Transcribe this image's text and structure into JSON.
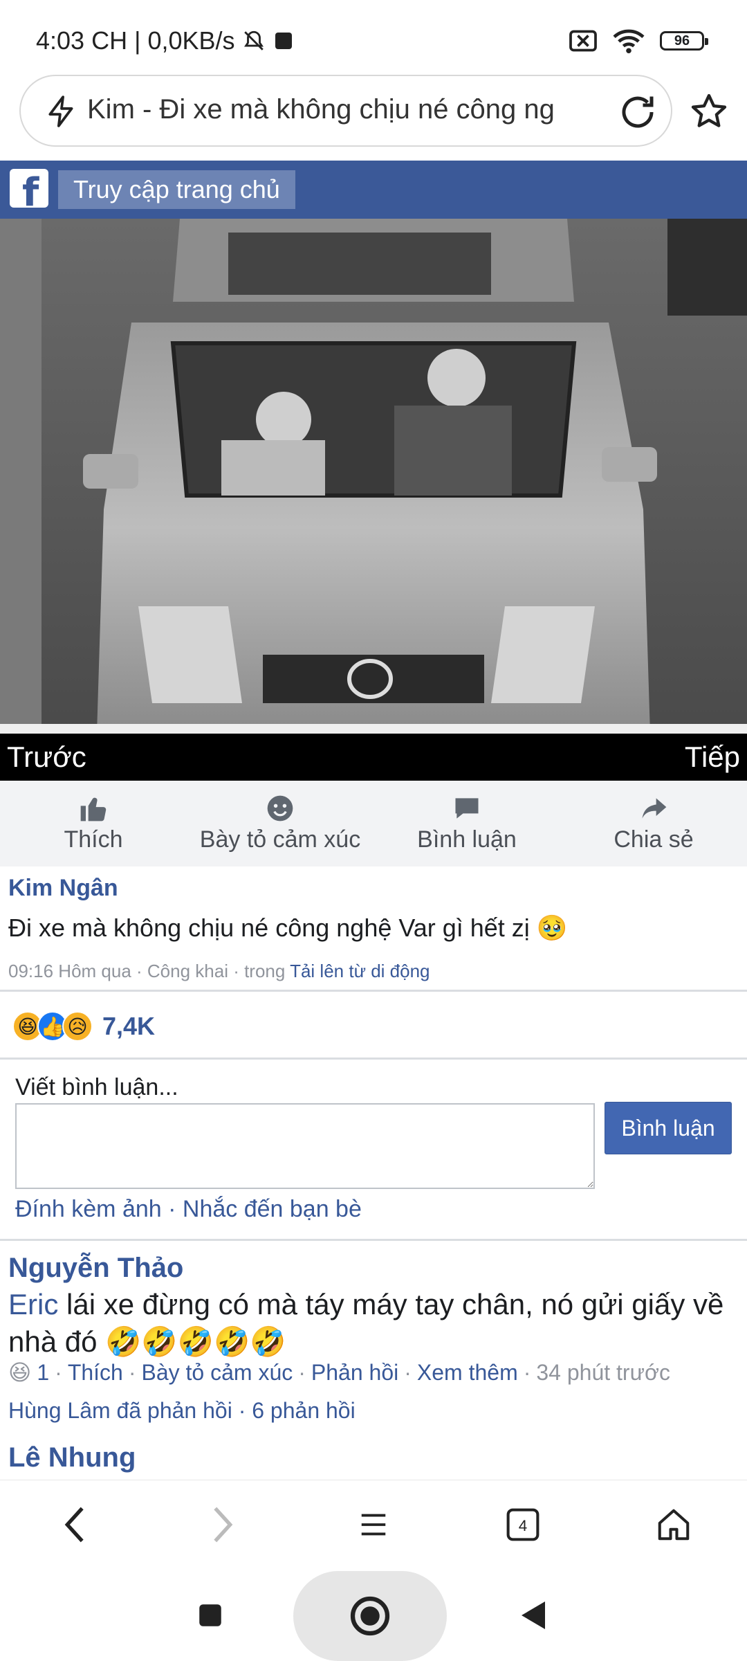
{
  "status_bar": {
    "time": "4:03 CH",
    "network_speed": "0,0KB/s",
    "battery": "96"
  },
  "browser": {
    "url_text": "Kim - Đi xe mà không chịu né công ng",
    "tab_count": "4"
  },
  "fb_header": {
    "logo": "f",
    "home_link": "Truy cập trang chủ"
  },
  "photo_nav": {
    "prev": "Trước",
    "next": "Tiếp"
  },
  "actions": [
    {
      "label": "Thích",
      "icon": "thumbs-up-icon"
    },
    {
      "label": "Bày tỏ cảm xúc",
      "icon": "smiley-icon"
    },
    {
      "label": "Bình luận",
      "icon": "comment-icon"
    },
    {
      "label": "Chia sẻ",
      "icon": "share-icon"
    }
  ],
  "post": {
    "author": "Kim Ngân",
    "text": "Đi xe mà không chịu né công nghệ Var gì hết zị",
    "text_emoji": "🥹",
    "meta_prefix": "09:16 Hôm qua · Công khai · trong ",
    "meta_link": "Tải lên từ di động",
    "reaction_emojis": [
      "😆",
      "👍",
      "😥"
    ],
    "reaction_count": "7,4K"
  },
  "comment_form": {
    "label": "Viết bình luận...",
    "input_value": "",
    "submit": "Bình luận",
    "attach_links": "Đính kèm ảnh · Nhắc đến bạn bè"
  },
  "comments": [
    {
      "author": "Nguyễn Thảo",
      "mention": "Eric",
      "text": " lái xe đừng có mà táy máy tay chân, nó gửi giấy về nhà đó ",
      "emojis": "🤣🤣🤣🤣🤣",
      "reaction_emoji": "😆",
      "reaction_count": "1",
      "like": "Thích",
      "react": "Bày tỏ cảm xúc",
      "reply": "Phản hồi",
      "more": "Xem thêm",
      "time": "34 phút trước",
      "replies": "Hùng Lâm đã phản hồi · 6 phản hồi"
    },
    {
      "author": "Lê Nhung"
    }
  ],
  "colors": {
    "fb_blue": "#3b5998",
    "link_blue": "#385898",
    "button_blue": "#4267b2"
  }
}
